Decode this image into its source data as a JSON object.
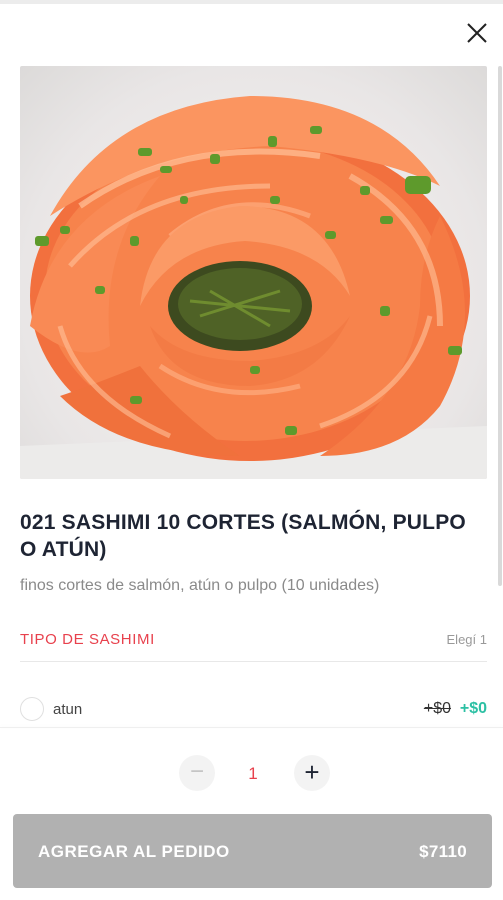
{
  "product": {
    "title": "021 SASHIMI 10 CORTES (SALMÓN, PULPO O ATÚN)",
    "description": "finos cortes de salmón, atún o pulpo (10 unidades)",
    "image_alt": "salmon sashimi rose with chives"
  },
  "options_section": {
    "title": "TIPO DE SASHIMI",
    "note": "Elegí 1",
    "options": [
      {
        "label": "atun",
        "price_old": "+$0",
        "price_new": "+$0",
        "selected": false
      }
    ]
  },
  "quantity": {
    "minus": "−",
    "value": "1",
    "plus": "+"
  },
  "add_button": {
    "label": "AGREGAR AL PEDIDO",
    "total": "$7110"
  },
  "icons": {
    "close": "close-icon"
  },
  "colors": {
    "accent_red": "#e8414d",
    "price_green": "#2cc0a4",
    "button_disabled": "#b1b1b1",
    "title": "#1e2433"
  }
}
